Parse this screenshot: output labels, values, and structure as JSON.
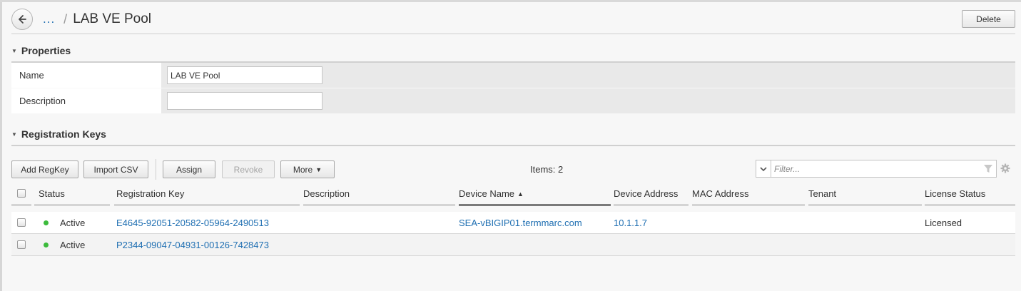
{
  "breadcrumb": {
    "ellipsis": "...",
    "separator": "/",
    "title": "LAB VE Pool"
  },
  "actions": {
    "delete_label": "Delete"
  },
  "properties": {
    "section_title": "Properties",
    "name_label": "Name",
    "name_value": "LAB VE Pool",
    "description_label": "Description",
    "description_value": ""
  },
  "registration_keys": {
    "section_title": "Registration Keys",
    "toolbar": {
      "add_regkey": "Add RegKey",
      "import_csv": "Import CSV",
      "assign": "Assign",
      "revoke": "Revoke",
      "more": "More"
    },
    "items_count": "Items: 2",
    "filter_placeholder": "Filter...",
    "columns": {
      "status": "Status",
      "registration_key": "Registration Key",
      "description": "Description",
      "device_name": "Device Name",
      "device_address": "Device Address",
      "mac_address": "MAC Address",
      "tenant": "Tenant",
      "license_status": "License Status"
    },
    "sorted_column": "Device Name",
    "sort_direction": "ascending",
    "rows": [
      {
        "status": "Active",
        "registration_key": "E4645-92051-20582-05964-2490513",
        "description": "",
        "device_name": "SEA-vBIGIP01.termmarc.com",
        "device_address": "10.1.1.7",
        "mac_address": "",
        "tenant": "",
        "license_status": "Licensed"
      },
      {
        "status": "Active",
        "registration_key": "P2344-09047-04931-00126-7428473",
        "description": "",
        "device_name": "",
        "device_address": "",
        "mac_address": "",
        "tenant": "",
        "license_status": ""
      }
    ]
  },
  "colors": {
    "link": "#1f6fb2",
    "active_status": "#3cbb3c"
  }
}
